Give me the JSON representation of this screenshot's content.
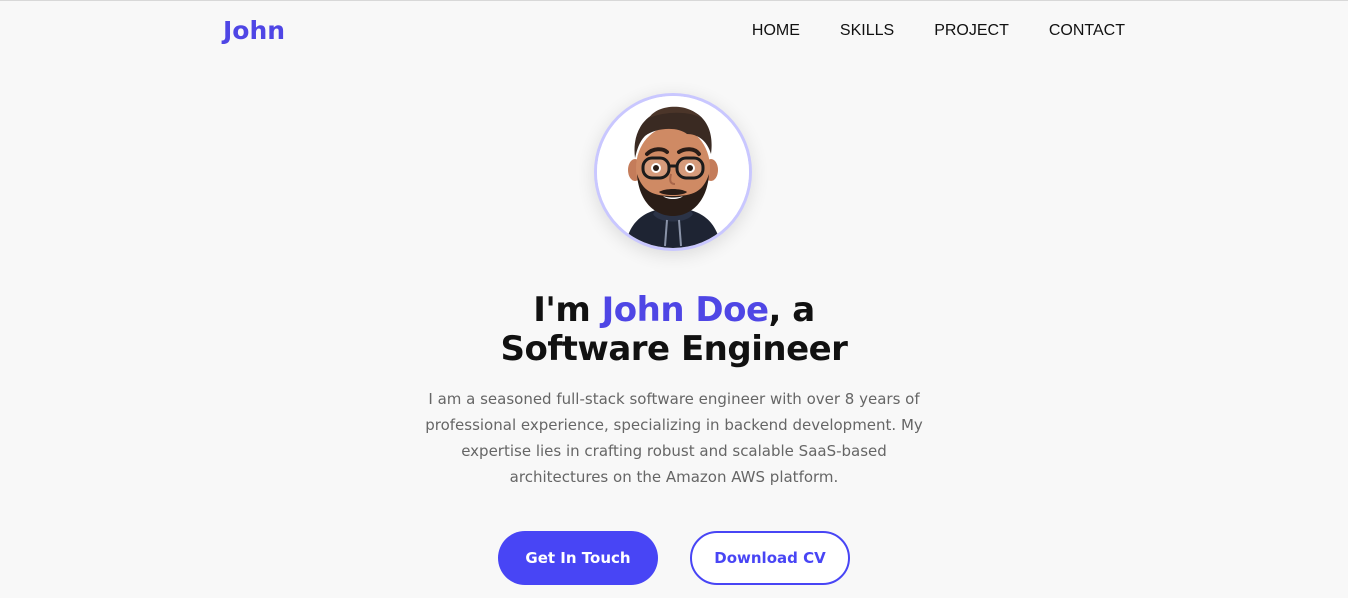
{
  "header": {
    "logo": "John",
    "nav": [
      "HOME",
      "SKILLS",
      "PROJECT",
      "CONTACT"
    ]
  },
  "hero": {
    "avatar_icon": "profile-avatar",
    "headline_prefix": "I'm ",
    "headline_name": "John Doe",
    "headline_suffix": ", a",
    "headline_line2": "Software Engineer",
    "intro": "I am a seasoned full-stack software engineer with over 8 years of professional experience, specializing in backend development. My expertise lies in crafting robust and scalable SaaS-based architectures on the Amazon AWS platform.",
    "primary_button": "Get In Touch",
    "secondary_button": "Download CV"
  },
  "colors": {
    "accent": "#4f46e5",
    "button": "#4845f5",
    "background": "#f8f8f8"
  }
}
